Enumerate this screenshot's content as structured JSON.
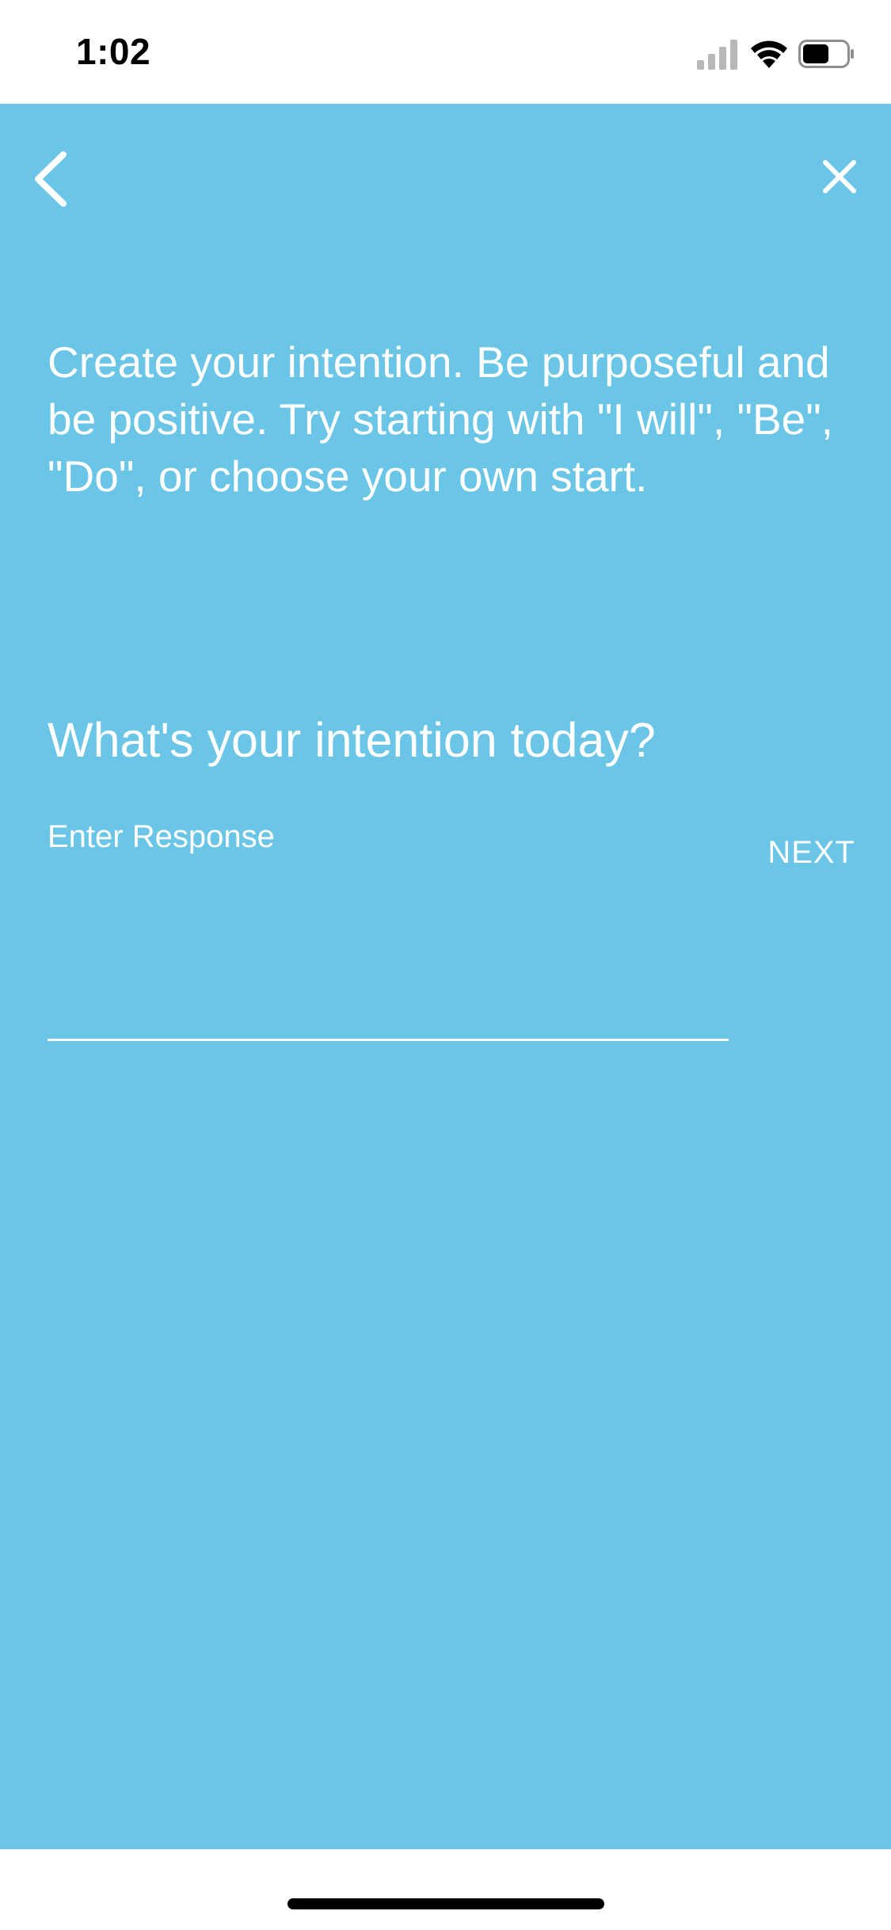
{
  "status_bar": {
    "time": "1:02",
    "signal_icon": "cellular-signal-icon",
    "wifi_icon": "wifi-icon",
    "battery_icon": "battery-icon",
    "battery_level": 0.6
  },
  "header": {
    "back_icon": "chevron-left-icon",
    "close_icon": "close-icon"
  },
  "main": {
    "instructions": "Create your intention. Be purposeful and be positive. Try starting with \"I will\", \"Be\", \"Do\", or choose your own start.",
    "question": "What's your intention today?",
    "response_placeholder": "Enter Response",
    "response_value": "",
    "next_label": "NEXT"
  },
  "colors": {
    "background": "#6ac5e6",
    "text": "#ffffff",
    "status_bar": "#ffffff"
  }
}
